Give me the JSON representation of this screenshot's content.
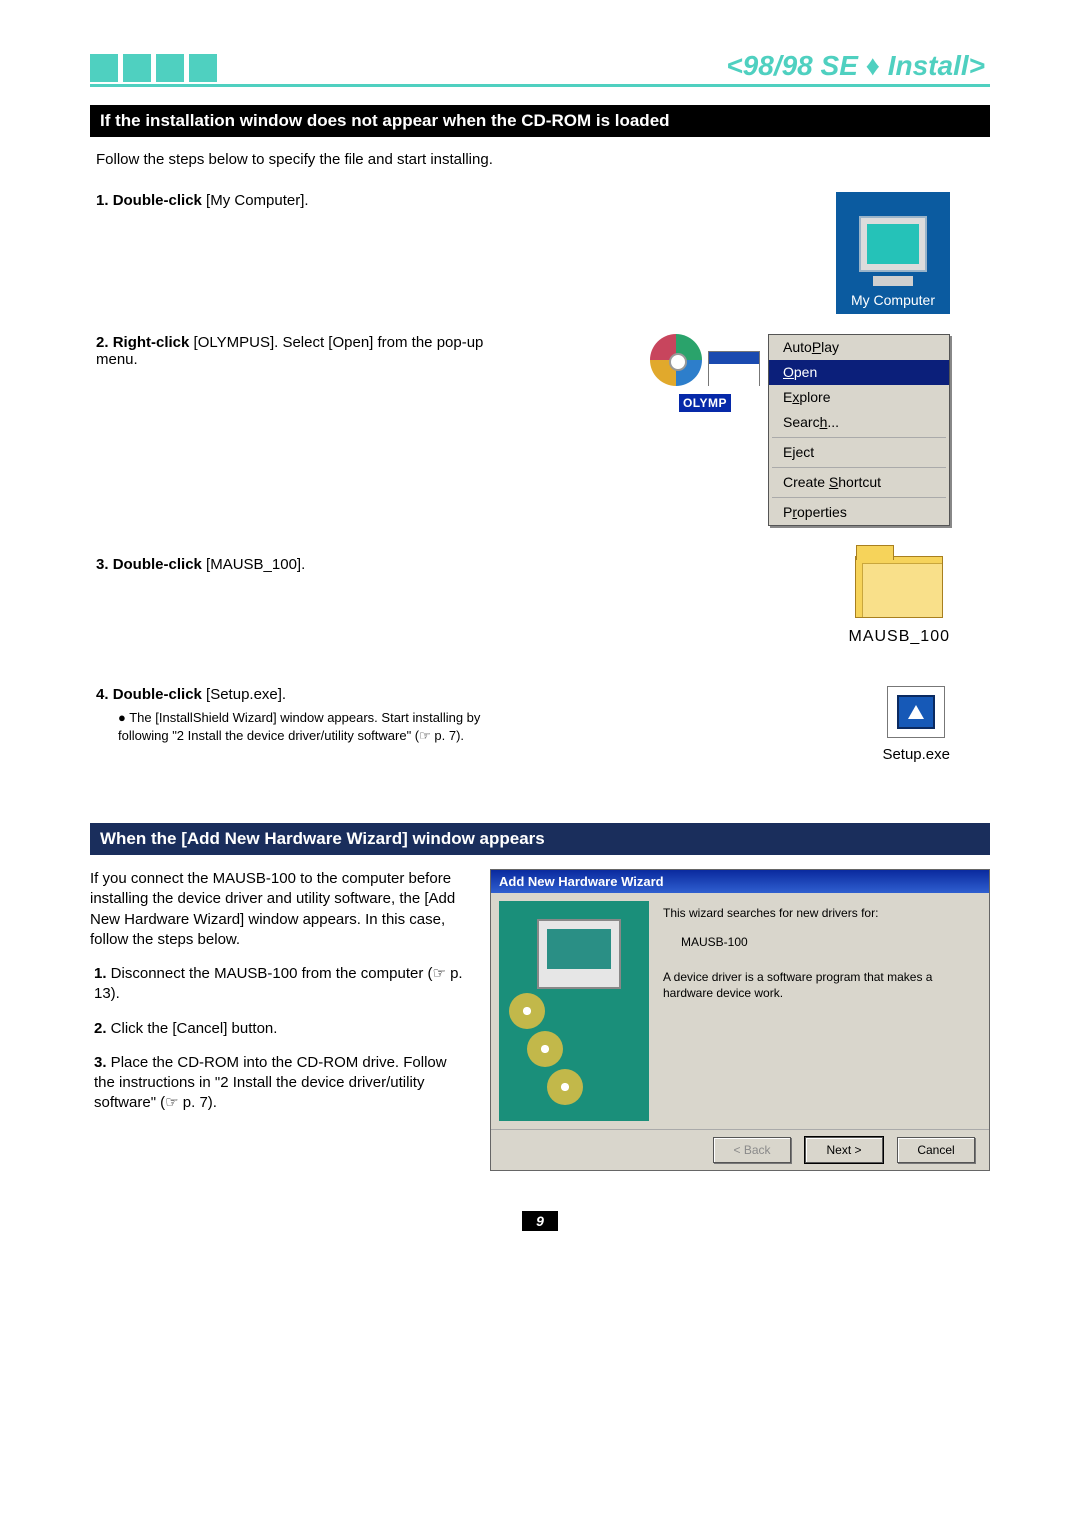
{
  "banner": {
    "title": "<98/98 SE ♦ Install>"
  },
  "section1": {
    "header": "If the installation window does not appear when the CD-ROM is loaded",
    "intro": "Follow the steps below to specify the file and start installing.",
    "step1_num": "1. ",
    "step1_bold": "Double-click",
    "step1_rest": " [My Computer].",
    "step2_num": "2. ",
    "step2_bold": "Right-click",
    "step2_rest": " [OLYMPUS]. Select [Open] from the pop-up menu.",
    "step3_num": "3. ",
    "step3_bold": "Double-click",
    "step3_rest": " [MAUSB_100].",
    "step4_num": "4. ",
    "step4_bold": "Double-click",
    "step4_rest": " [Setup.exe].",
    "step4_bullet": "The [InstallShield Wizard] window appears. Start installing by following \"2  Install the device driver/utility software\" (☞ p. 7).",
    "mycomputer_label": "My Computer",
    "olymp_label": "OLYMP",
    "ctx": {
      "autoplay": "AutoPlay",
      "open": "Open",
      "explore": "Explore",
      "search": "Search...",
      "eject": "Eject",
      "shortcut": "Create Shortcut",
      "properties": "Properties"
    },
    "folder_label": "MAUSB_100",
    "setup_label": "Setup.exe"
  },
  "section2": {
    "header": "When the [Add New Hardware Wizard] window appears",
    "intro": "If you connect the MAUSB-100 to the computer before installing the device driver and utility software, the [Add New Hardware Wizard] window appears. In this case, follow the steps below.",
    "s1_num": "1.",
    "s1_text": " Disconnect the MAUSB-100 from the computer (☞ p. 13).",
    "s2_num": "2.",
    "s2_text": " Click the [Cancel] button.",
    "s3_num": "3.",
    "s3_text": " Place the CD-ROM into the CD-ROM drive. Follow the instructions in \"2   Install the device driver/utility software\" (☞ p. 7)."
  },
  "wizard": {
    "title": "Add New Hardware Wizard",
    "line1": "This wizard searches for new drivers for:",
    "device": "MAUSB-100",
    "line2": "A device driver is a software program that makes a hardware device work.",
    "back": "< Back",
    "next": "Next >",
    "cancel": "Cancel"
  },
  "page_number": "9"
}
